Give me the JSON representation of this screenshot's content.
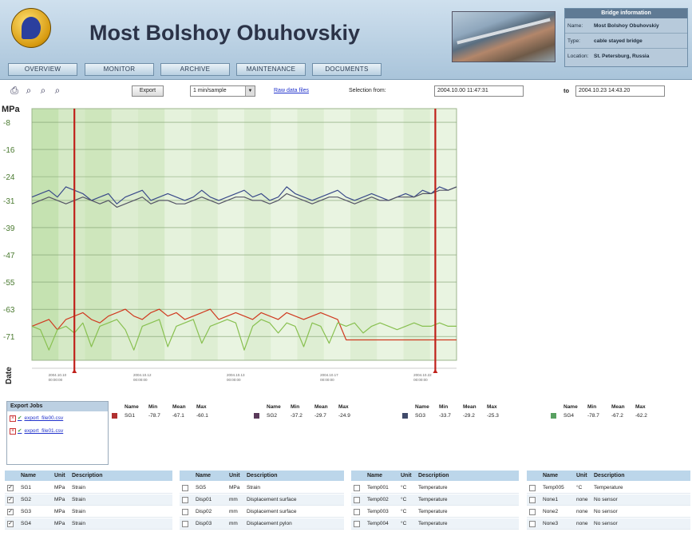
{
  "header": {
    "title": "Most Bolshoy Obuhovskiy",
    "nav": [
      "OVERVIEW",
      "MONITOR",
      "ARCHIVE",
      "MAINTENANCE",
      "DOCUMENTS"
    ],
    "info": {
      "title": "Bridge information",
      "rows": [
        {
          "key": "Name:",
          "value": "Most Bolshoy Obuhovskiy"
        },
        {
          "key": "Type:",
          "value": "cable stayed bridge"
        },
        {
          "key": "Location:",
          "value": "St. Petersburg, Russia"
        }
      ]
    }
  },
  "toolbar": {
    "export_label": "Export",
    "sample_value": "1 min/sample",
    "raw_link": "Raw data files",
    "selection_from_label": "Selection from:",
    "from_value": "2004.10.00 11:47:31",
    "to_label": "to",
    "to_value": "2004.10.23 14:43.20"
  },
  "chart_data": {
    "type": "line",
    "ylabel": "MPa",
    "xlabel": "Date",
    "y_ticks": [
      -8,
      -16,
      -24,
      -31,
      -39,
      -47,
      -55,
      -63,
      -71
    ],
    "ylim": [
      -78,
      -4
    ],
    "x_ticks": [
      "2004.10.10 00:00:00",
      "2004.10.12 00:00:00",
      "2004.10.13 00:00:00",
      "2004.10.17 00:00:00",
      "2004.10.22 00:00:00"
    ],
    "x_positions": [
      0.05,
      0.25,
      0.47,
      0.69,
      0.91
    ],
    "selection": [
      0.1,
      0.95
    ],
    "grid": true,
    "series": [
      {
        "color": "#3a4a8a",
        "values": [
          -30,
          -29,
          -28,
          -30,
          -27,
          -28,
          -29,
          -31,
          -30,
          -29,
          -32,
          -30,
          -29,
          -28,
          -31,
          -30,
          -29,
          -30,
          -31,
          -30,
          -28,
          -30,
          -31,
          -30,
          -29,
          -28,
          -30,
          -29,
          -31,
          -30,
          -27,
          -29,
          -30,
          -31,
          -30,
          -29,
          -28,
          -30,
          -31,
          -30,
          -29,
          -30,
          -31,
          -30,
          -29,
          -30,
          -28,
          -29,
          -27,
          -28,
          -27
        ]
      },
      {
        "color": "#555566",
        "values": [
          -32,
          -31,
          -30,
          -31,
          -32,
          -31,
          -30,
          -31,
          -32,
          -31,
          -33,
          -32,
          -31,
          -30,
          -32,
          -31,
          -31,
          -32,
          -32,
          -31,
          -30,
          -31,
          -32,
          -31,
          -30,
          -30,
          -31,
          -31,
          -32,
          -31,
          -29,
          -30,
          -31,
          -32,
          -31,
          -30,
          -30,
          -31,
          -32,
          -31,
          -30,
          -31,
          -31,
          -30,
          -30,
          -30,
          -29,
          -29,
          -28,
          -28,
          -27
        ]
      },
      {
        "color": "#d03a20",
        "values": [
          -68,
          -67,
          -66,
          -69,
          -66,
          -65,
          -64,
          -66,
          -67,
          -65,
          -64,
          -63,
          -65,
          -66,
          -64,
          -63,
          -65,
          -64,
          -66,
          -65,
          -64,
          -63,
          -66,
          -65,
          -64,
          -65,
          -66,
          -64,
          -65,
          -66,
          -64,
          -65,
          -66,
          -65,
          -64,
          -65,
          -66,
          -72,
          -72,
          -72,
          -72,
          -72,
          -72,
          -72,
          -72,
          -72,
          -72,
          -72,
          -72,
          -72,
          -72
        ]
      },
      {
        "color": "#88c050",
        "values": [
          -68,
          -69,
          -75,
          -69,
          -68,
          -70,
          -67,
          -74,
          -68,
          -67,
          -66,
          -69,
          -75,
          -68,
          -67,
          -66,
          -74,
          -68,
          -67,
          -66,
          -73,
          -68,
          -67,
          -66,
          -67,
          -75,
          -68,
          -66,
          -67,
          -70,
          -67,
          -68,
          -74,
          -67,
          -68,
          -73,
          -67,
          -68,
          -67,
          -70,
          -68,
          -67,
          -68,
          -69,
          -68,
          -67,
          -68,
          -68,
          -67,
          -68,
          -68
        ]
      }
    ]
  },
  "export_jobs": {
    "title": "Export Jobs",
    "items": [
      "export_file00.csv",
      "export_file01.csv"
    ]
  },
  "stats": {
    "headers": [
      "Name",
      "Min",
      "Mean",
      "Max"
    ],
    "groups": [
      {
        "color": "#b03030",
        "name": "SG1",
        "min": "-78.7",
        "mean": "-67.1",
        "max": "-60.1"
      },
      {
        "color": "#5a3a5a",
        "name": "SG2",
        "min": "-37.2",
        "mean": "-29.7",
        "max": "-24.9"
      },
      {
        "color": "#404a6a",
        "name": "SG3",
        "min": "-33.7",
        "mean": "-29.2",
        "max": "-25.3"
      },
      {
        "color": "#58a060",
        "name": "SG4",
        "min": "-78.7",
        "mean": "-67.2",
        "max": "-62.2"
      }
    ]
  },
  "sensor_tables": [
    {
      "headers": [
        "Name",
        "Unit",
        "Description"
      ],
      "rows": [
        {
          "checked": true,
          "name": "SG1",
          "unit": "MPa",
          "desc": "Strain"
        },
        {
          "checked": true,
          "name": "SG2",
          "unit": "MPa",
          "desc": "Strain"
        },
        {
          "checked": true,
          "name": "SG3",
          "unit": "MPa",
          "desc": "Strain"
        },
        {
          "checked": true,
          "name": "SG4",
          "unit": "MPa",
          "desc": "Strain"
        }
      ]
    },
    {
      "headers": [
        "Name",
        "Unit",
        "Description"
      ],
      "rows": [
        {
          "checked": false,
          "name": "SG5",
          "unit": "MPa",
          "desc": "Strain"
        },
        {
          "checked": false,
          "name": "Disp01",
          "unit": "mm",
          "desc": "Displacement surface"
        },
        {
          "checked": false,
          "name": "Disp02",
          "unit": "mm",
          "desc": "Displacement surface"
        },
        {
          "checked": false,
          "name": "Disp03",
          "unit": "mm",
          "desc": "Displacement pylon"
        }
      ]
    },
    {
      "headers": [
        "Name",
        "Unit",
        "Description"
      ],
      "rows": [
        {
          "checked": false,
          "name": "Temp001",
          "unit": "°C",
          "desc": "Temperature"
        },
        {
          "checked": false,
          "name": "Temp002",
          "unit": "°C",
          "desc": "Temperature"
        },
        {
          "checked": false,
          "name": "Temp003",
          "unit": "°C",
          "desc": "Temperature"
        },
        {
          "checked": false,
          "name": "Temp004",
          "unit": "°C",
          "desc": "Temperature"
        }
      ]
    },
    {
      "headers": [
        "Name",
        "Unit",
        "Description"
      ],
      "rows": [
        {
          "checked": false,
          "name": "Temp005",
          "unit": "°C",
          "desc": "Temperature"
        },
        {
          "checked": false,
          "name": "None1",
          "unit": "none",
          "desc": "No sensor"
        },
        {
          "checked": false,
          "name": "None2",
          "unit": "none",
          "desc": "No sensor"
        },
        {
          "checked": false,
          "name": "None3",
          "unit": "none",
          "desc": "No sensor"
        }
      ]
    }
  ]
}
